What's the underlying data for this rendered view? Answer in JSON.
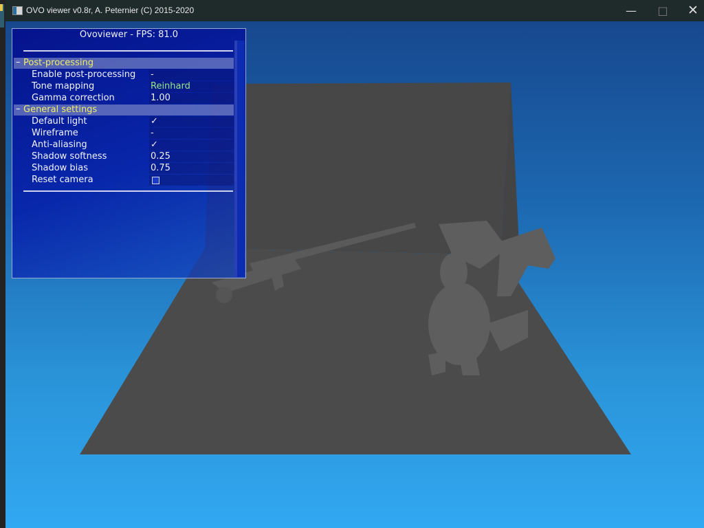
{
  "window": {
    "title": "OVO viewer v0.8r, A. Peternier (C) 2015-2020",
    "controls": {
      "minimize": "—",
      "maximize": "□",
      "close": "✕"
    }
  },
  "panel": {
    "title": "Ovoviewer - FPS: 81.0",
    "sections": {
      "post_processing": {
        "label": "Post-processing",
        "collapse": "–",
        "rows": {
          "enable_post_processing": {
            "name": "Enable post-processing",
            "value": "-"
          },
          "tone_mapping": {
            "name": "Tone mapping",
            "value": "Reinhard"
          },
          "gamma_correction": {
            "name": "Gamma correction",
            "value": "1.00"
          }
        }
      },
      "general_settings": {
        "label": "General settings",
        "collapse": "–",
        "rows": {
          "default_light": {
            "name": "Default light",
            "value": "✓"
          },
          "wireframe": {
            "name": "Wireframe",
            "value": "-"
          },
          "anti_aliasing": {
            "name": "Anti-aliasing",
            "value": "✓"
          },
          "shadow_softness": {
            "name": "Shadow softness",
            "value": "0.25"
          },
          "shadow_bias": {
            "name": "Shadow bias",
            "value": "0.75"
          },
          "reset_camera": {
            "name": "Reset camera",
            "value": ""
          }
        }
      }
    }
  },
  "colors": {
    "panel_bg": "#0a1f9c",
    "section_label": "#f2ef62",
    "value_green": "#93e98a",
    "viewport_top": "#17488e",
    "viewport_bottom": "#31a8f2",
    "scene_gray": "#4a4a4a"
  }
}
